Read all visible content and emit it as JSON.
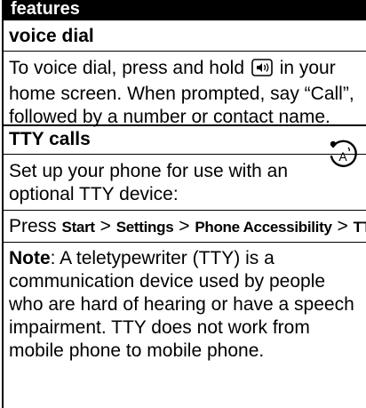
{
  "section": {
    "title": "features"
  },
  "voice_dial": {
    "heading": "voice dial",
    "line1_before_icon": "To voice dial, press and hold",
    "key_icon": "voice-key-icon",
    "line1_after_icon": "in your",
    "line2": "home screen. When prompted, say “Call”,",
    "line3": "followed by a number or contact name."
  },
  "tty_calls": {
    "heading": "TTY calls",
    "accessibility_icon": "accessibility-icon",
    "intro_line1": "Set up your phone for use with an",
    "intro_line2": "optional TTY device:",
    "press_label": "Press",
    "menu_path": [
      "Start",
      "Settings",
      "Phone Accessibility",
      "TTY"
    ],
    "separator": ">",
    "note_label": "Note",
    "note_line1_rest": ": A teletypewriter (TTY) is a",
    "note_line2": "communication device used by people",
    "note_line3": "who are hard of hearing or have a speech",
    "note_line4": "impairment. TTY does not work from",
    "note_line5": "mobile phone to mobile phone."
  }
}
